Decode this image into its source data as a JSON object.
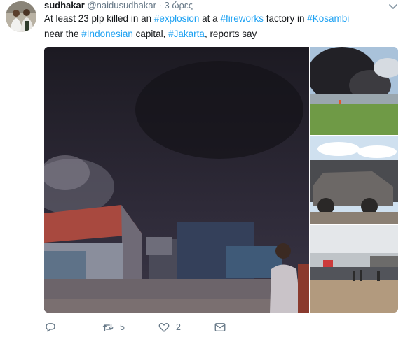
{
  "tweet": {
    "display_name": "sudhakar",
    "handle": "@naidusudhakar",
    "separator": "·",
    "time": "3 ώρες",
    "text_parts": {
      "p1": "At least 23 plp killed in an ",
      "h1": "#explosion",
      "p2": " at a ",
      "h2": "#fireworks",
      "p3": " factory in ",
      "h3": "#Kosambi",
      "p4": " near the ",
      "h4": "#Indonesian",
      "p5": " capital, ",
      "h5": "#Jakarta",
      "p6": ", reports say"
    },
    "actions": {
      "reply_count": "",
      "retweet_count": "5",
      "like_count": "2"
    }
  },
  "colors": {
    "link": "#1da1f2",
    "muted": "#657786"
  },
  "icons": [
    "chevron-down-icon",
    "reply-icon",
    "retweet-icon",
    "like-icon",
    "direct-message-icon"
  ]
}
